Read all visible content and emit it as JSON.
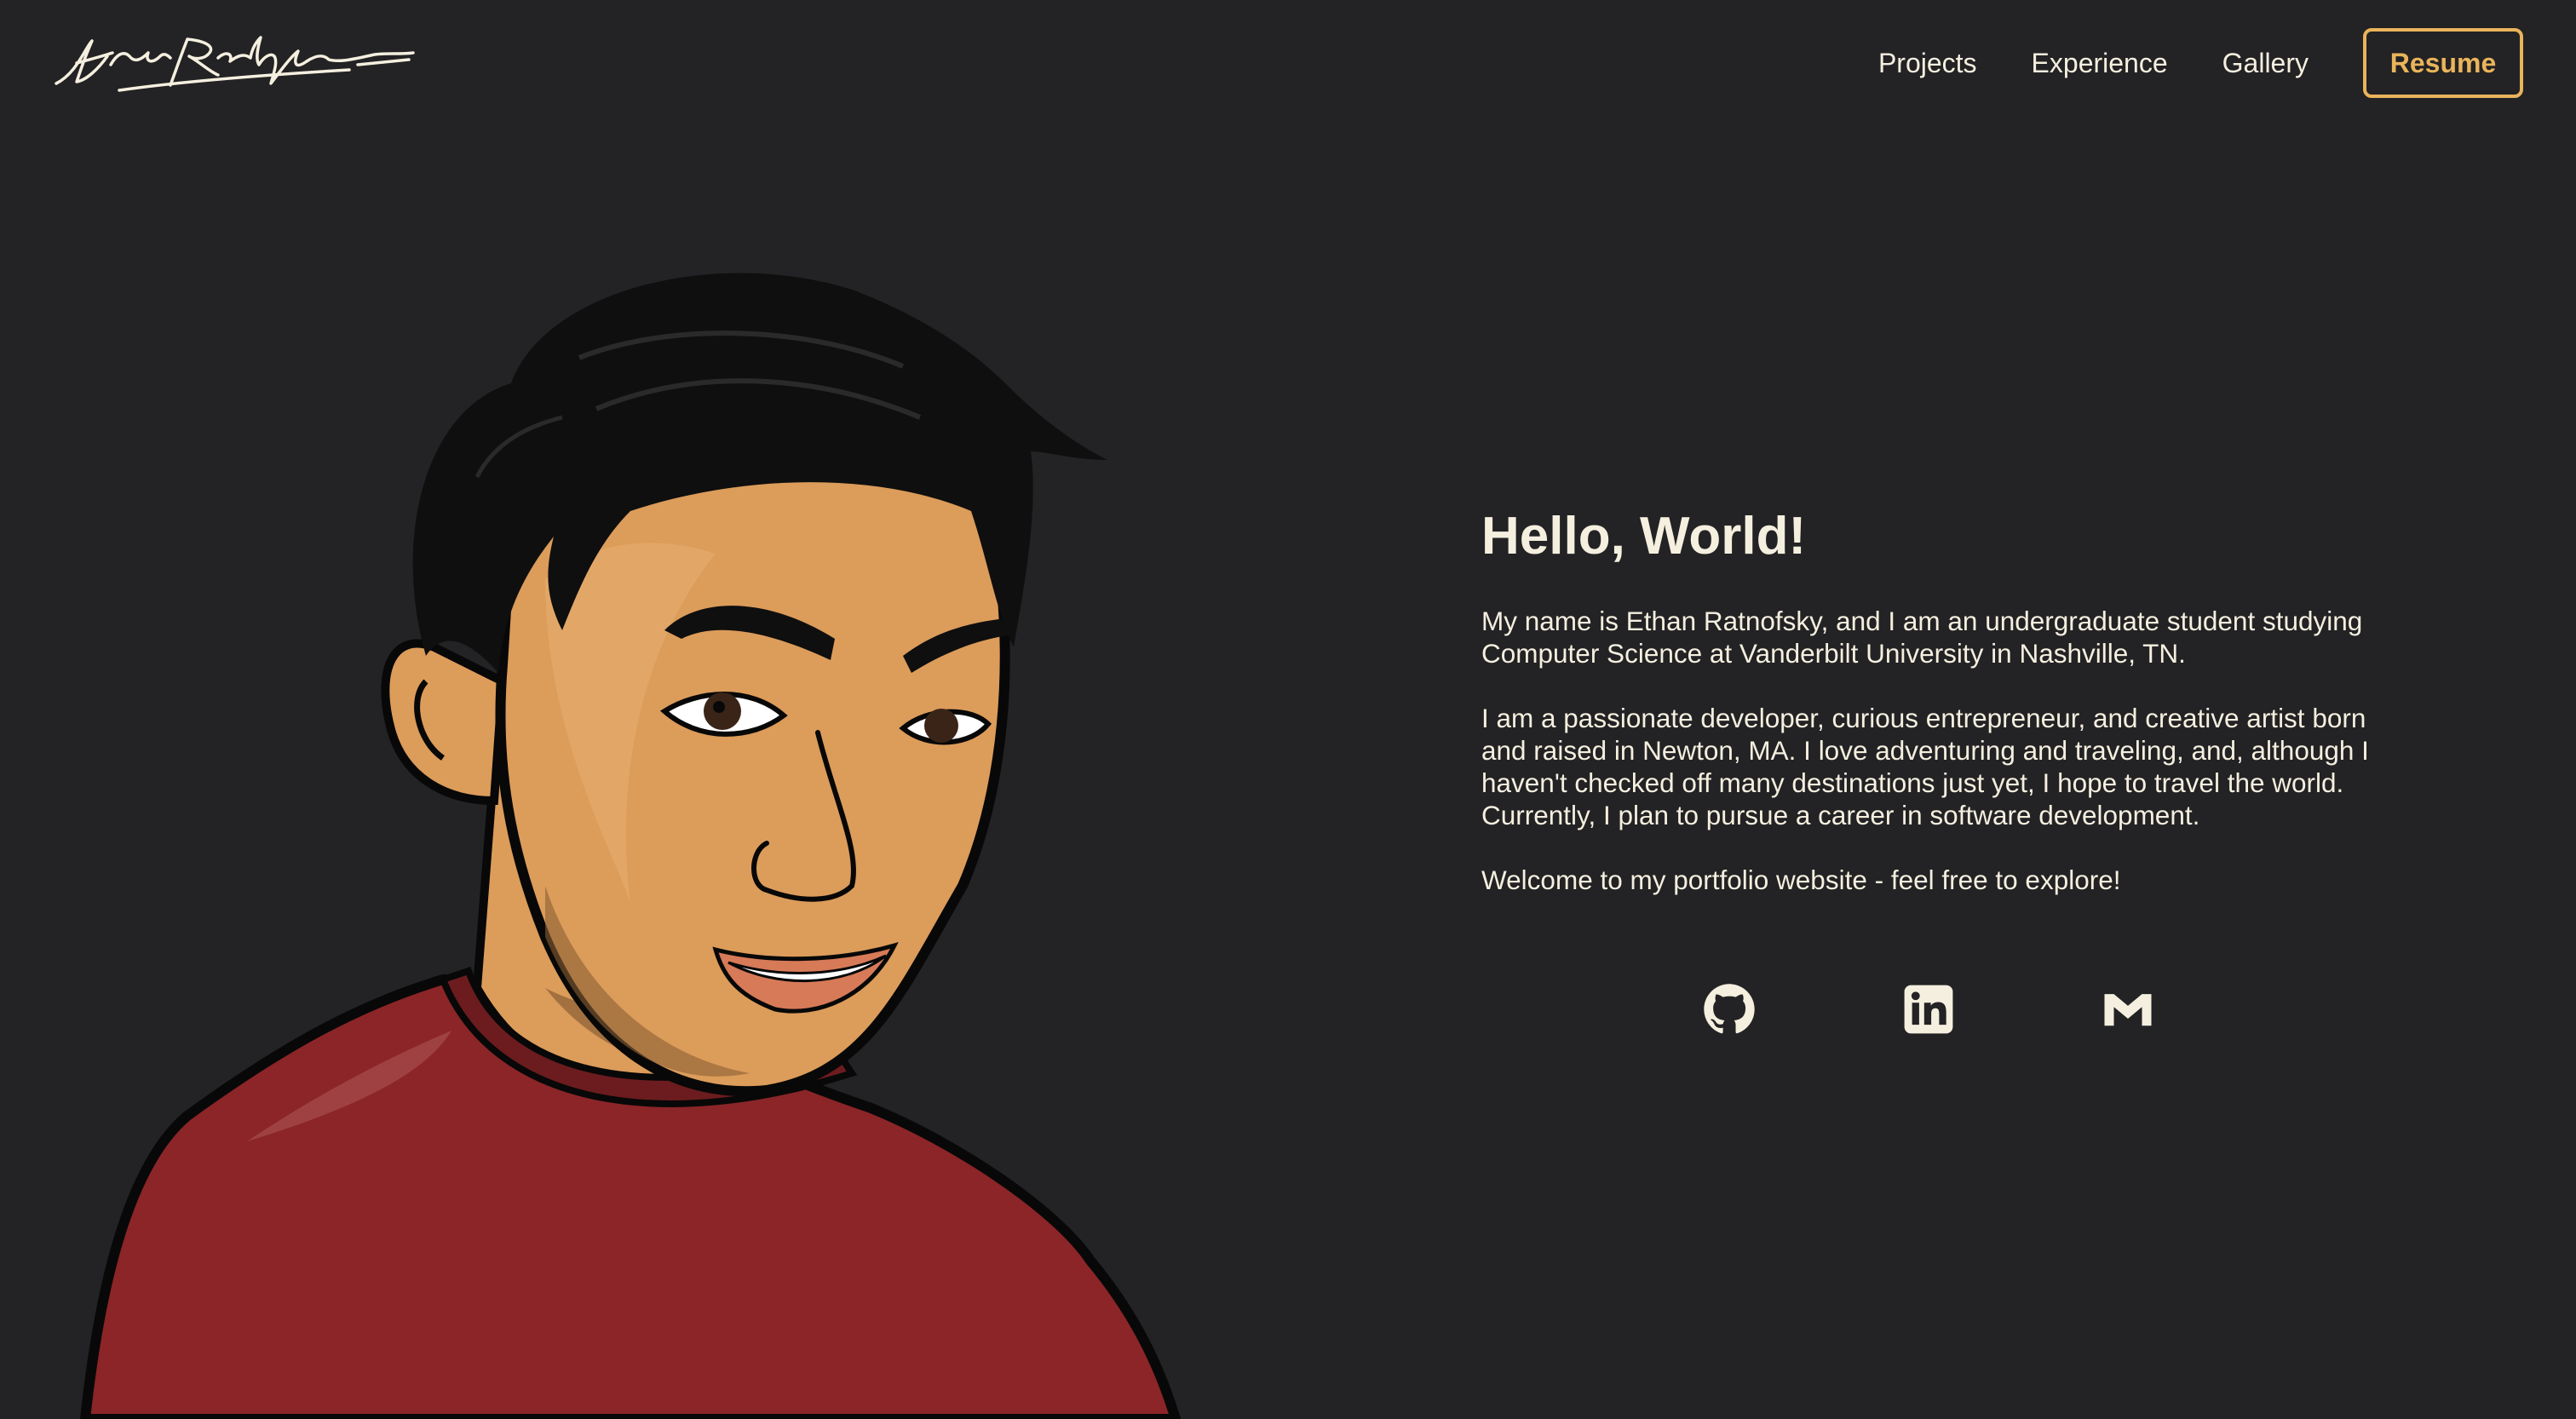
{
  "header": {
    "logo_alt": "Ethan Ratnofsky signature",
    "nav": [
      {
        "label": "Projects"
      },
      {
        "label": "Experience"
      },
      {
        "label": "Gallery"
      }
    ],
    "resume_label": "Resume"
  },
  "intro": {
    "title": "Hello, World!",
    "paragraphs": [
      "My name is Ethan Ratnofsky, and I am an undergraduate student studying Computer Science at Vanderbilt University in Nashville, TN.",
      "I am a passionate developer, curious entrepreneur, and creative artist born and raised in Newton, MA. I love adventuring and traveling, and, although I haven't checked off many destinations just yet, I hope to travel the world. Currently, I plan to pursue a career in software development.",
      "Welcome to my portfolio website - feel free to explore!"
    ]
  },
  "socials": [
    {
      "name": "github-icon",
      "label": "GitHub"
    },
    {
      "name": "linkedin-icon",
      "label": "LinkedIn"
    },
    {
      "name": "gmail-icon",
      "label": "Gmail"
    }
  ],
  "colors": {
    "background": "#232224",
    "text": "#f4efdf",
    "accent": "#e9b45b",
    "shirt": "#8b2528",
    "skin": "#dc9c5a",
    "hair": "#0f0f0f"
  }
}
